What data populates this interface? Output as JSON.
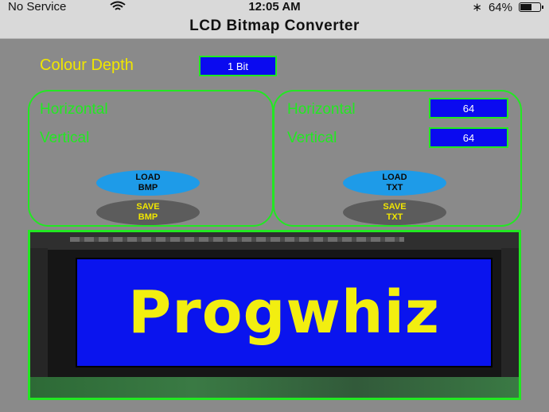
{
  "status": {
    "carrier": "No Service",
    "time": "12:05 AM",
    "bluetooth_glyph": "∗",
    "battery": "64%",
    "battery_level": 0.64
  },
  "nav": {
    "title": "LCD Bitmap Converter"
  },
  "depth": {
    "label": "Colour Depth",
    "value": "1 Bit"
  },
  "left_panel": {
    "horizontal_label": "Horizontal",
    "vertical_label": "Vertical",
    "load_label": "LOAD\nBMP",
    "save_label": "SAVE\nBMP"
  },
  "right_panel": {
    "horizontal_label": "Horizontal",
    "horizontal_value": "64",
    "vertical_label": "Vertical",
    "vertical_value": "64",
    "load_label": "LOAD\nTXT",
    "save_label": "SAVE\nTXT"
  },
  "preview": {
    "text": "Progwhiz"
  },
  "icons": [
    "wifi-icon",
    "bluetooth-icon",
    "battery-icon"
  ],
  "colors": {
    "accent_green": "#22e822",
    "label_yellow": "#f0e600",
    "field_blue": "#0a0af0",
    "load_button": "#1e9be8",
    "save_button": "#5c5c5c"
  }
}
